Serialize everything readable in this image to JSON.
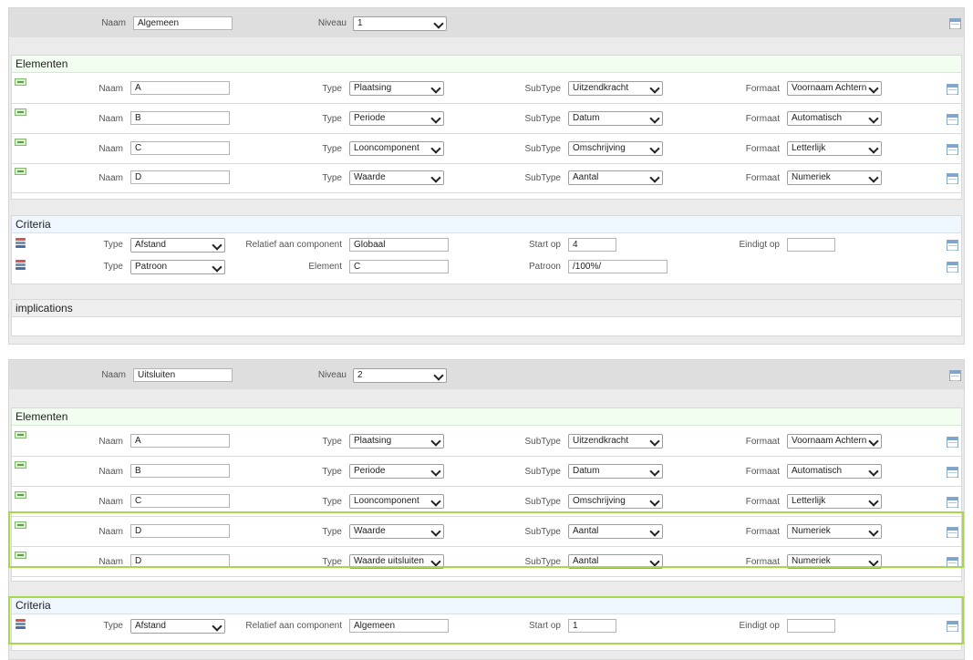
{
  "labels": {
    "naam": "Naam",
    "niveau": "Niveau",
    "type": "Type",
    "subtype": "SubType",
    "formaat": "Formaat",
    "relatief": "Relatief aan component",
    "start_op": "Start op",
    "eindigt_op": "Eindigt op",
    "element": "Element",
    "patroon": "Patroon"
  },
  "sections": {
    "elementen": "Elementen",
    "criteria": "Criteria",
    "implications": "implications"
  },
  "blocks": [
    {
      "naam": "Algemeen",
      "niveau": "1",
      "elements": [
        {
          "naam": "A",
          "type": "Plaatsing",
          "subtype": "Uitzendkracht",
          "formaat": "Voornaam Achtern"
        },
        {
          "naam": "B",
          "type": "Periode",
          "subtype": "Datum",
          "formaat": "Automatisch"
        },
        {
          "naam": "C",
          "type": "Looncomponent",
          "subtype": "Omschrijving",
          "formaat": "Letterlijk"
        },
        {
          "naam": "D",
          "type": "Waarde",
          "subtype": "Aantal",
          "formaat": "Numeriek"
        }
      ],
      "criteria": [
        {
          "type": "Afstand",
          "relatief": "Globaal",
          "start_op": "4",
          "eindigt_op": ""
        },
        {
          "type": "Patroon",
          "element": "C",
          "patroon": "/100%/"
        }
      ]
    },
    {
      "naam": "Uitsluiten",
      "niveau": "2",
      "elements": [
        {
          "naam": "A",
          "type": "Plaatsing",
          "subtype": "Uitzendkracht",
          "formaat": "Voornaam Achtern"
        },
        {
          "naam": "B",
          "type": "Periode",
          "subtype": "Datum",
          "formaat": "Automatisch"
        },
        {
          "naam": "C",
          "type": "Looncomponent",
          "subtype": "Omschrijving",
          "formaat": "Letterlijk"
        },
        {
          "naam": "D",
          "type": "Waarde",
          "subtype": "Aantal",
          "formaat": "Numeriek"
        },
        {
          "naam": "D",
          "type": "Waarde uitsluiten",
          "subtype": "Aantal",
          "formaat": "Numeriek"
        }
      ],
      "criteria": [
        {
          "type": "Afstand",
          "relatief": "Algemeen",
          "start_op": "1",
          "eindigt_op": ""
        }
      ]
    }
  ],
  "colors": {
    "highlight": "#a8d84a",
    "elementen_header": "#f2fff0",
    "criteria_header": "#eef6ff"
  },
  "icons": {
    "element_row": "add-element-icon",
    "criteria_row": "criteria-stack-icon",
    "row_menu": "list-icon"
  }
}
